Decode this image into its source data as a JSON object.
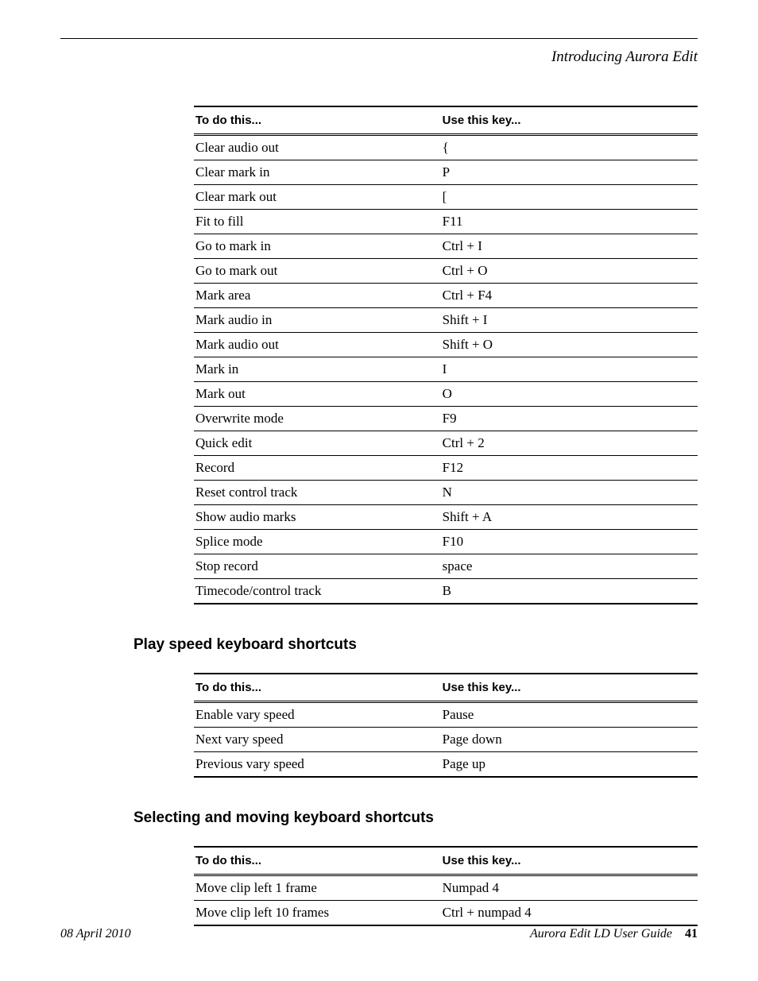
{
  "running_head": "Introducing Aurora Edit",
  "table_headers": {
    "col1": "To do this...",
    "col2": "Use this key..."
  },
  "table1": [
    {
      "action": "Clear audio out",
      "key": "{"
    },
    {
      "action": "Clear mark in",
      "key": "P"
    },
    {
      "action": "Clear mark out",
      "key": "["
    },
    {
      "action": "Fit to fill",
      "key": "F11"
    },
    {
      "action": "Go to mark in",
      "key": "Ctrl + I"
    },
    {
      "action": "Go to mark out",
      "key": "Ctrl + O"
    },
    {
      "action": "Mark area",
      "key": "Ctrl + F4"
    },
    {
      "action": "Mark audio in",
      "key": "Shift + I"
    },
    {
      "action": "Mark audio out",
      "key": "Shift + O"
    },
    {
      "action": "Mark in",
      "key": "I"
    },
    {
      "action": "Mark out",
      "key": "O"
    },
    {
      "action": "Overwrite mode",
      "key": "F9"
    },
    {
      "action": "Quick edit",
      "key": "Ctrl + 2"
    },
    {
      "action": "Record",
      "key": "F12"
    },
    {
      "action": "Reset control track",
      "key": "N"
    },
    {
      "action": "Show audio marks",
      "key": "Shift + A"
    },
    {
      "action": "Splice mode",
      "key": "F10"
    },
    {
      "action": "Stop record",
      "key": "space"
    },
    {
      "action": "Timecode/control track",
      "key": "B"
    }
  ],
  "section2_title": "Play speed keyboard shortcuts",
  "table2": [
    {
      "action": "Enable vary speed",
      "key": "Pause"
    },
    {
      "action": "Next vary speed",
      "key": "Page down"
    },
    {
      "action": "Previous vary speed",
      "key": "Page up"
    }
  ],
  "section3_title": "Selecting and moving keyboard shortcuts",
  "table3": [
    {
      "action": "Move clip left 1 frame",
      "key": "Numpad 4"
    },
    {
      "action": "Move clip left 10 frames",
      "key": "Ctrl + numpad 4"
    }
  ],
  "footer": {
    "date": "08 April 2010",
    "guide": "Aurora Edit LD User Guide",
    "page": "41"
  }
}
